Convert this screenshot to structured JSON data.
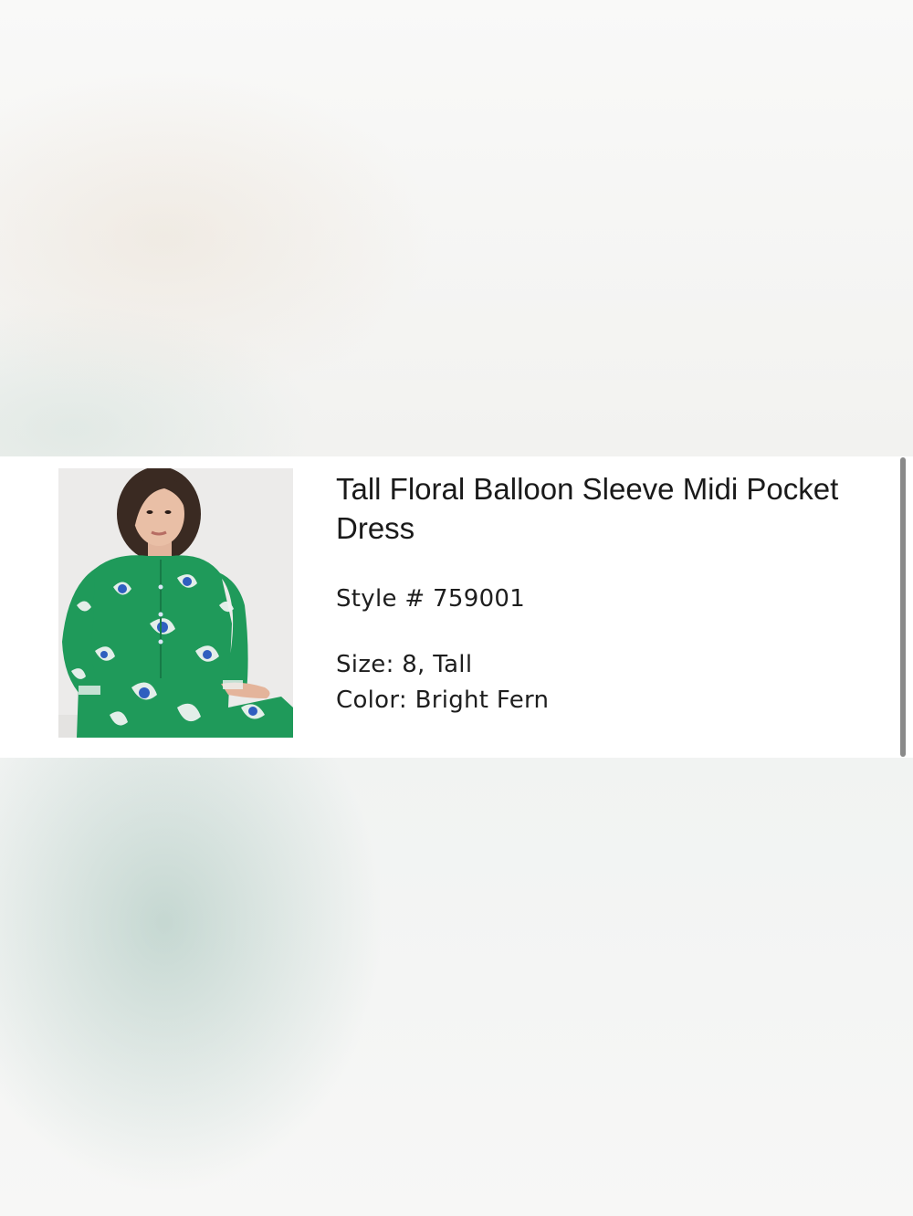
{
  "product": {
    "title": "Tall Floral Balloon Sleeve Midi Pocket Dress",
    "style_label": "Style #",
    "style_number": "759001",
    "size_label": "Size:",
    "size_value": "8, Tall",
    "color_label": "Color:",
    "color_value": "Bright Fern"
  },
  "colors": {
    "card_background": "#ffffff",
    "dress_green": "#1f9a5a",
    "print_white": "#eef3f1",
    "print_blue": "#2f5fbf",
    "text": "#1a1a1a"
  }
}
